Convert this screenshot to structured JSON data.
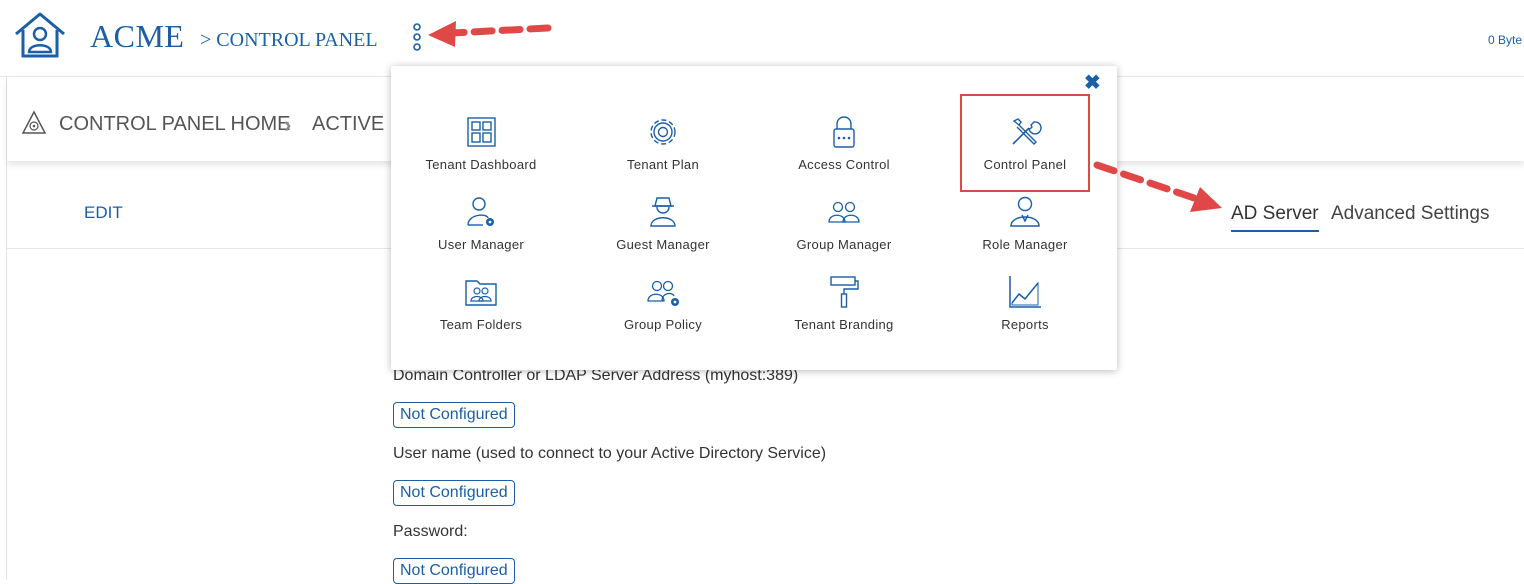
{
  "header": {
    "brand": "ACME",
    "crumb": "> CONTROL PANEL",
    "storage": "0 Byte"
  },
  "subheader": {
    "home": "CONTROL PANEL HOME",
    "active": "ACTIVE DIRECTORY"
  },
  "toolbar": {
    "edit": "EDIT"
  },
  "tabs": {
    "ad_server": "AD Server",
    "advanced": "Advanced Settings"
  },
  "form": {
    "label1": "Domain Controller or LDAP Server Address (myhost:389)",
    "value1": "Not Configured",
    "label2": "User name (used to connect to your Active Directory Service)",
    "value2": "Not Configured",
    "label3": "Password:",
    "value3": "Not Configured"
  },
  "menu": {
    "close": "✖",
    "items": [
      {
        "label": "Tenant Dashboard",
        "icon": "dashboard-grid-icon"
      },
      {
        "label": "Tenant Plan",
        "icon": "gear-icon"
      },
      {
        "label": "Access Control",
        "icon": "lock-icon"
      },
      {
        "label": "Control Panel",
        "icon": "tools-icon"
      },
      {
        "label": "User Manager",
        "icon": "user-gear-icon"
      },
      {
        "label": "Guest Manager",
        "icon": "guest-hat-icon"
      },
      {
        "label": "Group Manager",
        "icon": "group-icon"
      },
      {
        "label": "Role Manager",
        "icon": "role-user-icon"
      },
      {
        "label": "Team Folders",
        "icon": "team-folder-icon"
      },
      {
        "label": "Group Policy",
        "icon": "group-gear-icon"
      },
      {
        "label": "Tenant Branding",
        "icon": "paint-roller-icon"
      },
      {
        "label": "Reports",
        "icon": "chart-icon"
      }
    ]
  },
  "colors": {
    "accent": "#1a5fa8",
    "annotation": "#e04848"
  }
}
